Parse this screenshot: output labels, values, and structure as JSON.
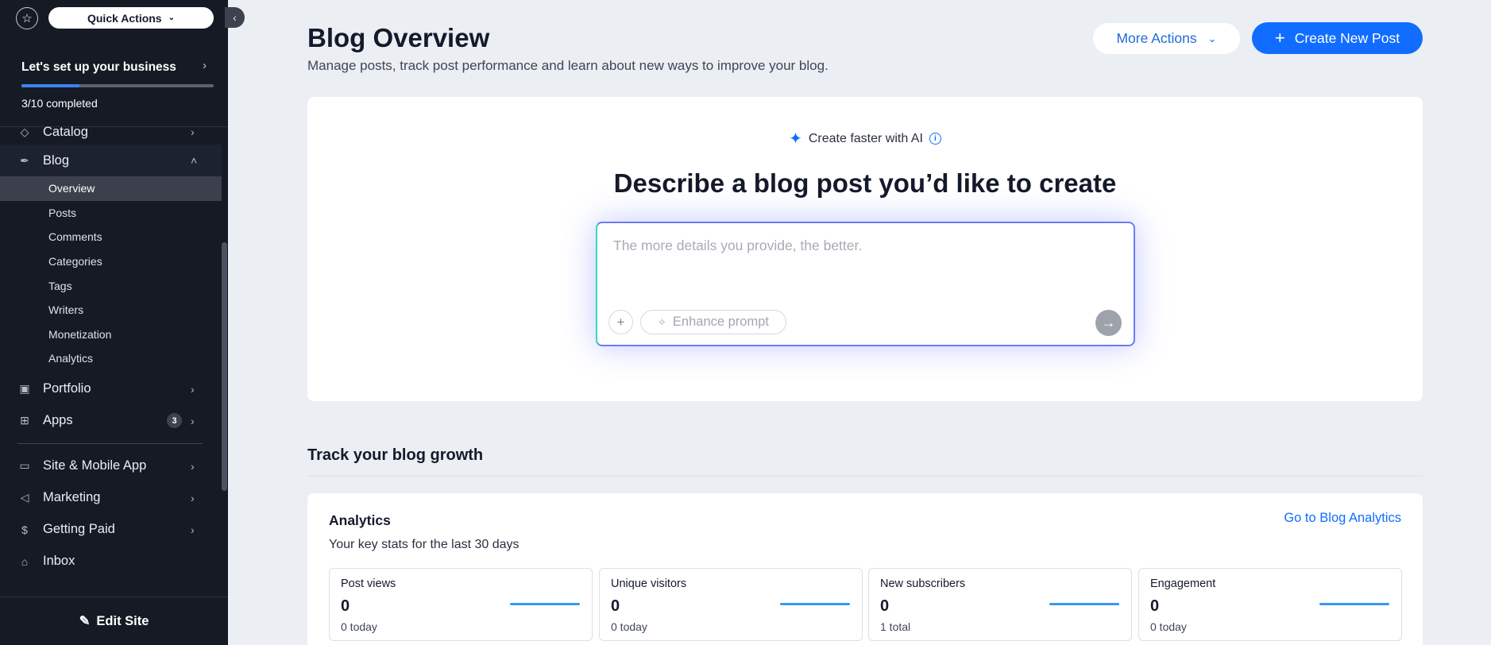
{
  "sidebar": {
    "quick_actions_label": "Quick Actions",
    "setup": {
      "title": "Let's set up your business",
      "progress_fraction": 0.3,
      "count_text": "3/10 completed"
    },
    "nav_top": [
      {
        "label": "Catalog"
      },
      {
        "label": "Blog"
      }
    ],
    "blog_sub": [
      {
        "label": "Overview",
        "active": true
      },
      {
        "label": "Posts"
      },
      {
        "label": "Comments"
      },
      {
        "label": "Categories"
      },
      {
        "label": "Tags"
      },
      {
        "label": "Writers"
      },
      {
        "label": "Monetization"
      },
      {
        "label": "Analytics"
      }
    ],
    "portfolio_label": "Portfolio",
    "apps": {
      "label": "Apps",
      "badge": "3"
    },
    "nav_bottom": [
      {
        "label": "Site & Mobile App"
      },
      {
        "label": "Marketing"
      },
      {
        "label": "Getting Paid"
      },
      {
        "label": "Inbox"
      }
    ],
    "edit_site_label": "Edit Site"
  },
  "header": {
    "title": "Blog Overview",
    "subtitle": "Manage posts, track post performance and learn about new ways to improve your blog.",
    "more_actions_label": "More Actions",
    "create_post_label": "Create New Post"
  },
  "ai": {
    "label": "Create faster with AI",
    "heading": "Describe a blog post you’d like to create",
    "placeholder": "The more details you provide, the better.",
    "value": "",
    "enhance_label": "Enhance prompt"
  },
  "growth": {
    "section_title": "Track your blog growth",
    "card_title": "Analytics",
    "card_subtitle": "Your key stats for the last 30 days",
    "link_label": "Go to Blog Analytics",
    "stats": [
      {
        "label": "Post views",
        "value": "0",
        "note": "0 today"
      },
      {
        "label": "Unique visitors",
        "value": "0",
        "note": "0 today"
      },
      {
        "label": "New subscribers",
        "value": "0",
        "note": "1 total"
      },
      {
        "label": "Engagement",
        "value": "0",
        "note": "0 today"
      }
    ]
  },
  "colors": {
    "accent": "#116dff",
    "sidebar_bg": "#151a25",
    "page_bg": "#ebeef3"
  }
}
